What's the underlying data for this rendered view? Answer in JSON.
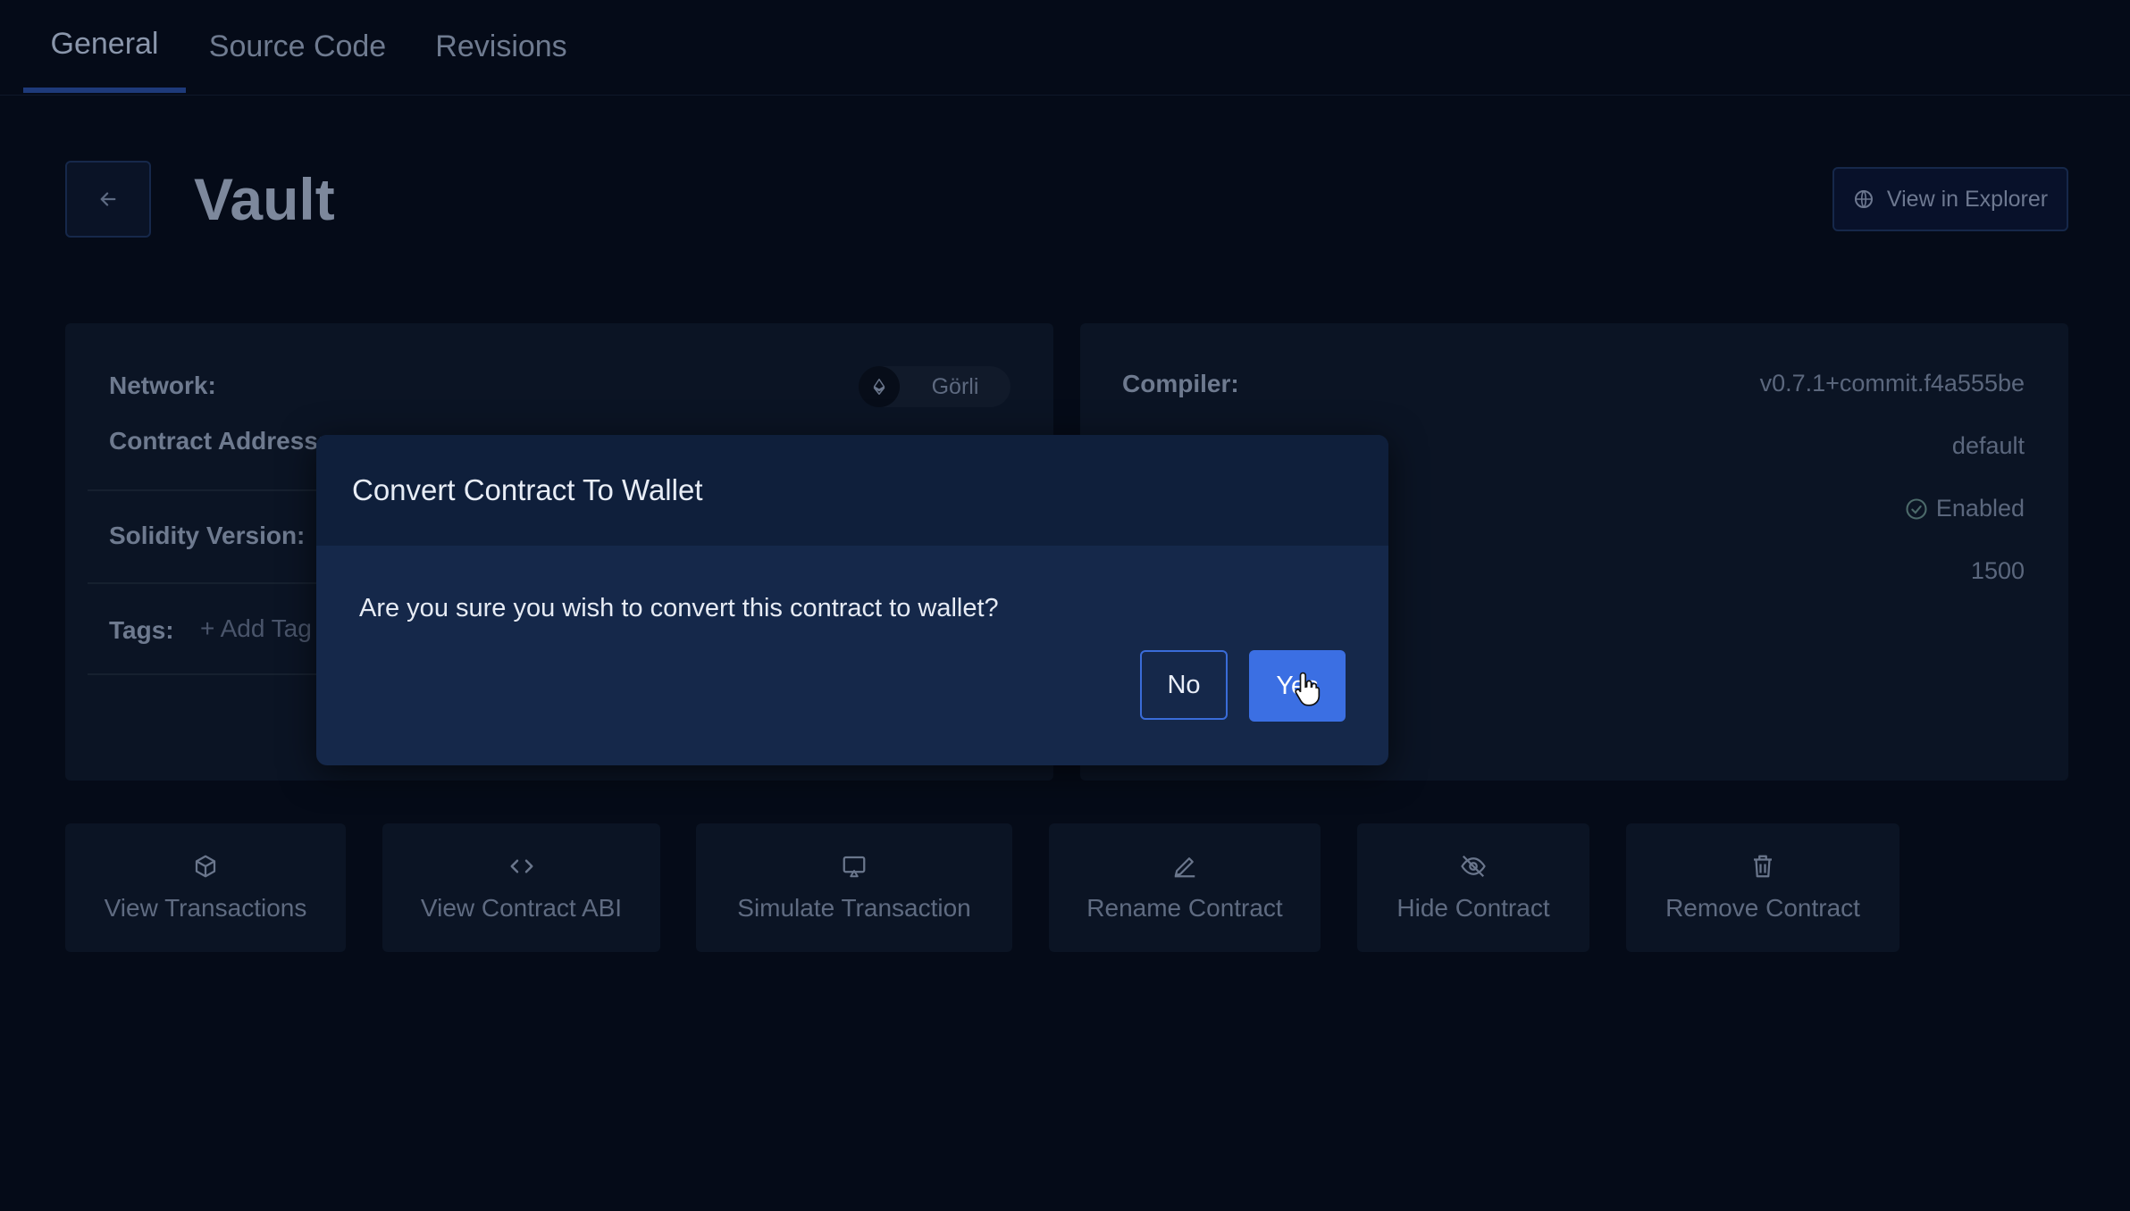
{
  "tabs": [
    {
      "label": "General",
      "active": true
    },
    {
      "label": "Source Code",
      "active": false
    },
    {
      "label": "Revisions",
      "active": false
    }
  ],
  "header": {
    "back_icon": "arrow-left-icon",
    "title": "Vault",
    "explorer_label": "View in Explorer",
    "explorer_icon": "globe-icon"
  },
  "left_card": {
    "network_label": "Network:",
    "network_value": "Görli",
    "network_icon": "ethereum-icon",
    "contract_address_label": "Contract Address:",
    "solidity_version_label": "Solidity Version:",
    "tags_label": "Tags:",
    "add_tag_label": "+ Add Tag"
  },
  "right_card": {
    "compiler_label": "Compiler:",
    "compiler_value": "v0.7.1+commit.f4a555be",
    "evm_value": "default",
    "optimizer_value": "Enabled",
    "optimizer_icon": "check-circle-icon",
    "runs_value": "1500"
  },
  "actions": [
    {
      "label": "View Transactions",
      "icon": "cube-icon"
    },
    {
      "label": "View Contract ABI",
      "icon": "code-icon"
    },
    {
      "label": "Simulate Transaction",
      "icon": "monitor-play-icon"
    },
    {
      "label": "Rename Contract",
      "icon": "pencil-icon"
    },
    {
      "label": "Hide Contract",
      "icon": "eye-off-icon"
    },
    {
      "label": "Remove Contract",
      "icon": "trash-icon"
    }
  ],
  "modal": {
    "title": "Convert Contract To Wallet",
    "message": "Are you sure you wish to convert this contract to wallet?",
    "no_label": "No",
    "yes_label": "Yes"
  },
  "colors": {
    "background": "#050b18",
    "card": "#0b1424",
    "modal": "#15284a",
    "modal_header": "#0f1f3b",
    "primary": "#3b6fe3"
  }
}
